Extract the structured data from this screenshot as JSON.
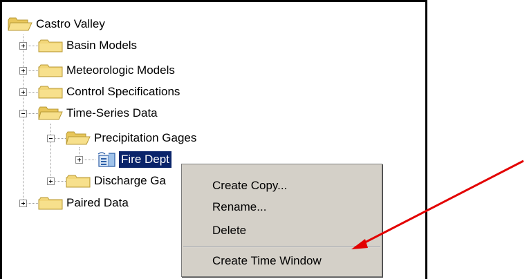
{
  "tree": {
    "root": "Castro Valley",
    "items": [
      {
        "label": "Basin Models"
      },
      {
        "label": "Meteorologic Models"
      },
      {
        "label": "Control Specifications"
      },
      {
        "label": "Time-Series Data"
      },
      {
        "label": "Precipitation Gages"
      },
      {
        "label": "Fire Dept"
      },
      {
        "label": "Discharge Ga"
      },
      {
        "label": "Paired Data"
      }
    ]
  },
  "context_menu": {
    "items": [
      {
        "label": "Create Copy..."
      },
      {
        "label": "Rename..."
      },
      {
        "label": "Delete"
      },
      {
        "label": "Create Time Window"
      }
    ]
  },
  "colors": {
    "selection": "#0a246a",
    "menu_background": "#d4d0c8",
    "folder": "#f2d679",
    "arrow": "#e30000"
  },
  "icons": {
    "folder": "folder-icon",
    "gage": "precipitation-gage-icon",
    "arrow": "red-arrow"
  }
}
